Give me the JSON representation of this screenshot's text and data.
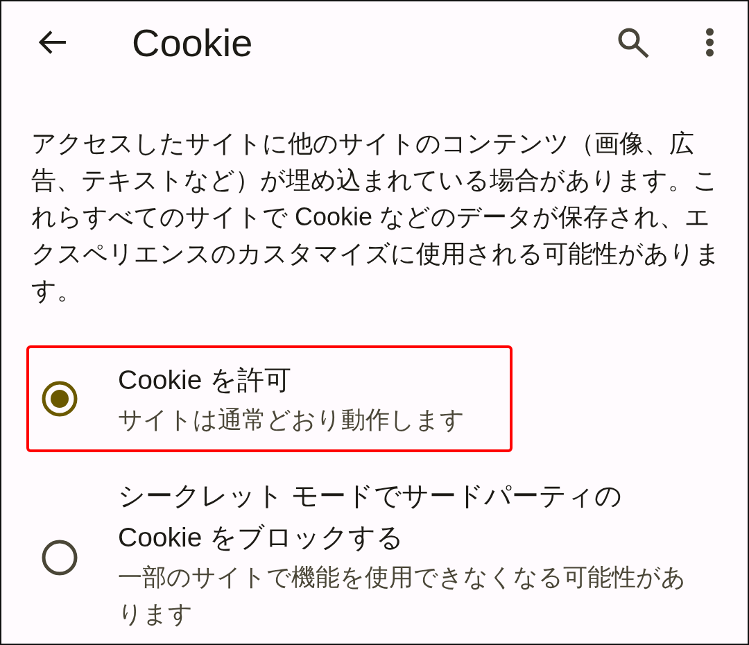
{
  "app_bar": {
    "title": "Cookie"
  },
  "description": "アクセスしたサイトに他のサイトのコンテンツ（画像、広告、テキストなど）が埋め込まれている場合があります。これらすべてのサイトで Cookie などのデータが保存され、エクスペリエンスのカスタマイズに使用される可能性があります。",
  "options": [
    {
      "title": "Cookie を許可",
      "subtitle": "サイトは通常どおり動作します",
      "selected": true,
      "highlighted": true
    },
    {
      "title": "シークレット モードでサードパーティの Cookie をブロックする",
      "subtitle": "一部のサイトで機能を使用できなくなる可能性があります",
      "selected": false,
      "highlighted": false
    }
  ]
}
